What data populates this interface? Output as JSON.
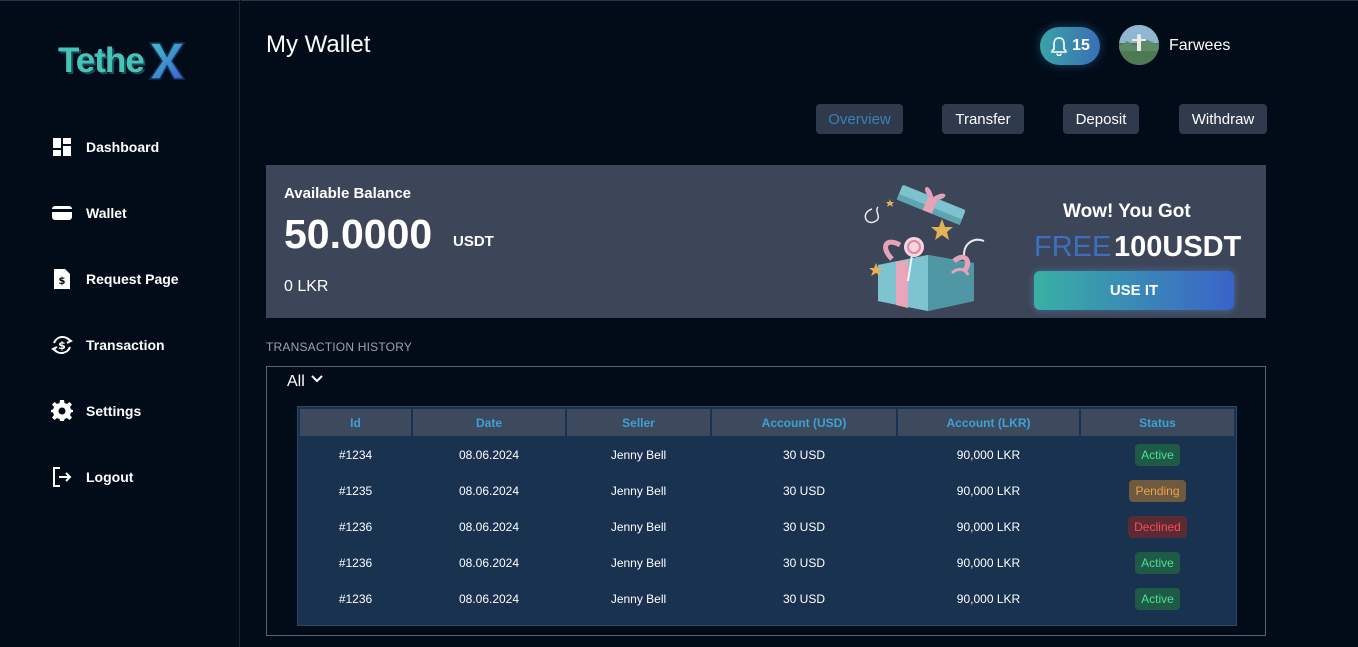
{
  "brand": {
    "logo_text": "Tethe",
    "logo_x": "X"
  },
  "sidebar": {
    "items": [
      {
        "label": "Dashboard",
        "icon": "dashboard-icon"
      },
      {
        "label": "Wallet",
        "icon": "wallet-icon"
      },
      {
        "label": "Request Page",
        "icon": "document-icon"
      },
      {
        "label": "Transaction",
        "icon": "transaction-icon"
      },
      {
        "label": "Settings",
        "icon": "gear-icon"
      },
      {
        "label": "Logout",
        "icon": "logout-icon"
      }
    ]
  },
  "header": {
    "title": "My Wallet",
    "notifications": "15",
    "username": "Farwees"
  },
  "tabs": [
    {
      "label": "Overview",
      "active": true
    },
    {
      "label": "Transfer",
      "active": false
    },
    {
      "label": "Deposit",
      "active": false
    },
    {
      "label": "Withdraw",
      "active": false
    }
  ],
  "balance": {
    "label": "Available Balance",
    "value": "50.0000",
    "unit": "USDT",
    "lkr": "0 LKR"
  },
  "promo": {
    "title": "Wow! You Got",
    "free": "FREE",
    "amount": "100USDT",
    "button": "USE IT"
  },
  "history": {
    "label": "TRANSACTION HISTORY",
    "filter": "All",
    "columns": [
      "Id",
      "Date",
      "Seller",
      "Account (USD)",
      "Account (LKR)",
      "Status"
    ],
    "rows": [
      {
        "id": "#1234",
        "date": "08.06.2024",
        "seller": "Jenny Bell",
        "usd": "30 USD",
        "lkr": "90,000 LKR",
        "status": "Active"
      },
      {
        "id": "#1235",
        "date": "08.06.2024",
        "seller": "Jenny Bell",
        "usd": "30 USD",
        "lkr": "90,000 LKR",
        "status": "Pending"
      },
      {
        "id": "#1236",
        "date": "08.06.2024",
        "seller": "Jenny Bell",
        "usd": "30 USD",
        "lkr": "90,000 LKR",
        "status": "Declined"
      },
      {
        "id": "#1236",
        "date": "08.06.2024",
        "seller": "Jenny Bell",
        "usd": "30 USD",
        "lkr": "90,000 LKR",
        "status": "Active"
      },
      {
        "id": "#1236",
        "date": "08.06.2024",
        "seller": "Jenny Bell",
        "usd": "30 USD",
        "lkr": "90,000 LKR",
        "status": "Active"
      }
    ]
  },
  "colors": {
    "background": "#020c19",
    "panel": "#3d4558",
    "accent": "#3da1d8",
    "status_active_bg": "#1e5a45",
    "status_active_fg": "#4ee08f",
    "status_pending_bg": "#6e5a3e",
    "status_pending_fg": "#f0a24a",
    "status_declined_bg": "#5a2a35",
    "status_declined_fg": "#ff4a57"
  }
}
